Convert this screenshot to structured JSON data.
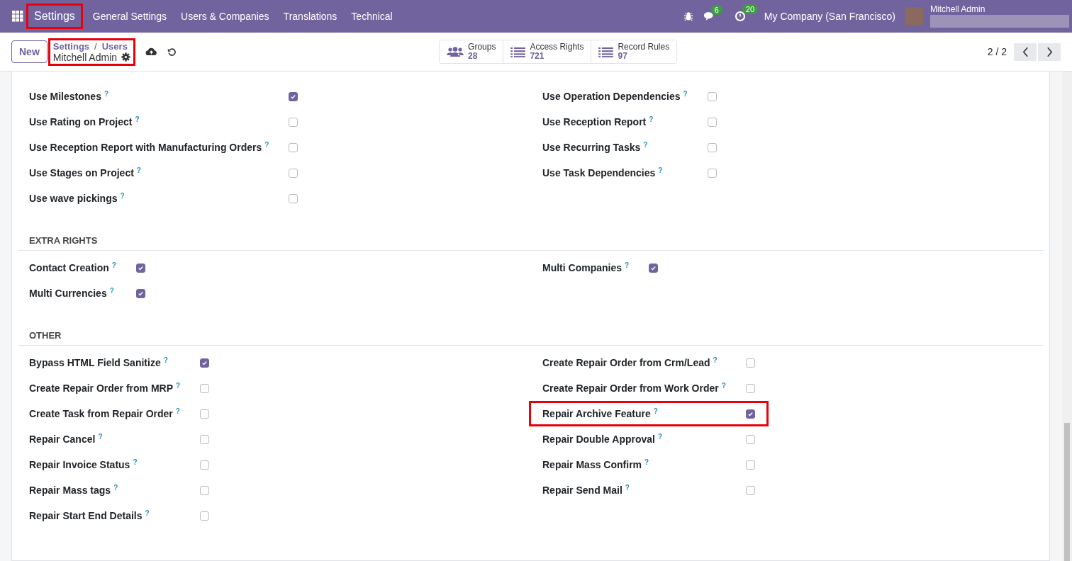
{
  "navbar": {
    "app": {
      "label": "Settings",
      "highlighted": true
    },
    "menus": [
      "General Settings",
      "Users & Companies",
      "Translations",
      "Technical"
    ],
    "messages_count": "6",
    "activities_count": "20",
    "company": "My Company (San Francisco)",
    "user": "Mitchell Admin"
  },
  "control_panel": {
    "new_button": "New",
    "breadcrumb": {
      "highlighted": true,
      "separator": "/",
      "path": [
        "Settings",
        "Users"
      ],
      "current": "Mitchell Admin"
    },
    "stat_buttons": [
      {
        "kind": "groups",
        "label": "Groups",
        "value": "28"
      },
      {
        "kind": "list",
        "label": "Access Rights",
        "value": "721"
      },
      {
        "kind": "list",
        "label": "Record Rules",
        "value": "97"
      }
    ],
    "pager": "2 / 2"
  },
  "sections": [
    {
      "columns": [
        [
          {
            "label": "Use Milestones",
            "help": "?",
            "checked": true,
            "highlighted": false
          },
          {
            "label": "Use Rating on Project",
            "help": "?",
            "checked": false,
            "highlighted": false
          },
          {
            "label": "Use Reception Report with Manufacturing Orders",
            "help": "?",
            "checked": false,
            "highlighted": false
          },
          {
            "label": "Use Stages on Project",
            "help": "?",
            "checked": false,
            "highlighted": false
          },
          {
            "label": "Use wave pickings",
            "help": "?",
            "checked": false,
            "highlighted": false
          }
        ],
        [
          {
            "label": "Use Operation Dependencies",
            "help": "?",
            "checked": false,
            "highlighted": false
          },
          {
            "label": "Use Reception Report",
            "help": "?",
            "checked": false,
            "highlighted": false
          },
          {
            "label": "Use Recurring Tasks",
            "help": "?",
            "checked": false,
            "highlighted": false
          },
          {
            "label": "Use Task Dependencies",
            "help": "?",
            "checked": false,
            "highlighted": false
          }
        ]
      ]
    },
    {
      "title": "EXTRA RIGHTS",
      "columns": [
        [
          {
            "label": "Contact Creation",
            "help": "?",
            "checked": true,
            "highlighted": false
          },
          {
            "label": "Multi Currencies",
            "help": "?",
            "checked": true,
            "highlighted": false
          }
        ],
        [
          {
            "label": "Multi Companies",
            "help": "?",
            "checked": true,
            "highlighted": false
          }
        ]
      ]
    },
    {
      "title": "OTHER",
      "columns": [
        [
          {
            "label": "Bypass HTML Field Sanitize",
            "help": "?",
            "checked": true,
            "highlighted": false
          },
          {
            "label": "Create Repair Order from MRP",
            "help": "?",
            "checked": false,
            "highlighted": false
          },
          {
            "label": "Create Task from Repair Order",
            "help": "?",
            "checked": false,
            "highlighted": false
          },
          {
            "label": "Repair Cancel",
            "help": "?",
            "checked": false,
            "highlighted": false
          },
          {
            "label": "Repair Invoice Status",
            "help": "?",
            "checked": false,
            "highlighted": false
          },
          {
            "label": "Repair Mass tags",
            "help": "?",
            "checked": false,
            "highlighted": false
          },
          {
            "label": "Repair Start End Details",
            "help": "?",
            "checked": false,
            "highlighted": false
          }
        ],
        [
          {
            "label": "Create Repair Order from Crm/Lead",
            "help": "?",
            "checked": false,
            "highlighted": false
          },
          {
            "label": "Create Repair Order from Work Order",
            "help": "?",
            "checked": false,
            "highlighted": false
          },
          {
            "label": "Repair Archive Feature",
            "help": "?",
            "checked": true,
            "highlighted": true
          },
          {
            "label": "Repair Double Approval",
            "help": "?",
            "checked": false,
            "highlighted": false
          },
          {
            "label": "Repair Mass Confirm",
            "help": "?",
            "checked": false,
            "highlighted": false
          },
          {
            "label": "Repair Send Mail",
            "help": "?",
            "checked": false,
            "highlighted": false
          }
        ]
      ]
    }
  ]
}
